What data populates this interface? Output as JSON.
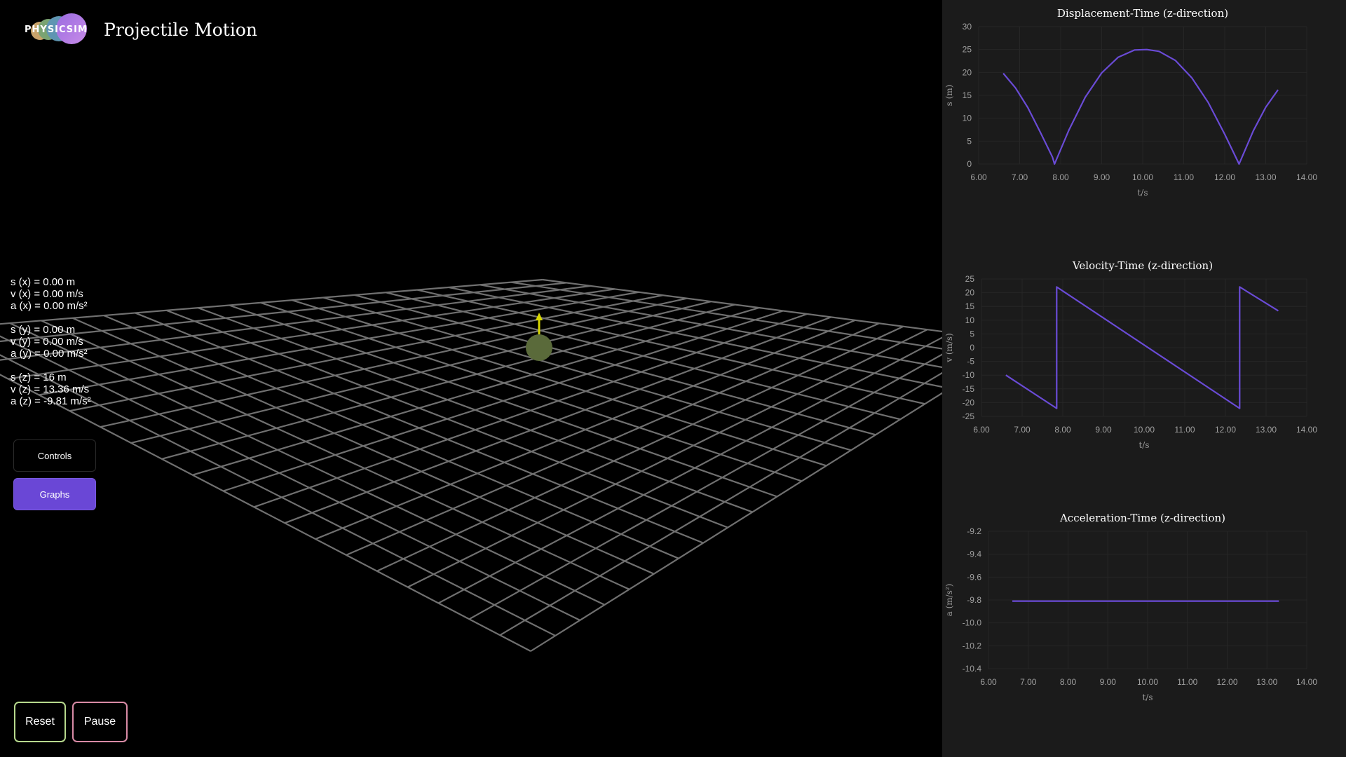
{
  "app": {
    "logo_text": "PHYSICSIM",
    "title": "Projectile Motion"
  },
  "readouts": {
    "x": [
      "s (x) = 0.00 m",
      "v (x) = 0.00 m/s",
      "a (x) = 0.00 m/s²"
    ],
    "y": [
      "s (y) = 0.00 m",
      "v (y) = 0.00 m/s",
      "a (y) = 0.00 m/s²"
    ],
    "z": [
      "s (z) = 16 m",
      "v (z) = 13.36 m/s",
      "a (z) = -9.81 m/s²"
    ]
  },
  "buttons": {
    "controls": "Controls",
    "graphs": "Graphs",
    "reset": "Reset",
    "pause": "Pause"
  },
  "colors": {
    "series": "#6a4bd6",
    "arrow": "#d6d600",
    "ball": "#5a6a3a",
    "graphs_button": "#6a47d6",
    "reset_border": "#b7d98d",
    "pause_border": "#d98ba6"
  },
  "chart_data": [
    {
      "type": "line",
      "title": "Displacement-Time (z-direction)",
      "xlabel": "t/s",
      "ylabel": "s (m)",
      "xlim": [
        6,
        14
      ],
      "ylim": [
        0,
        30
      ],
      "xticks": [
        "6.00",
        "7.00",
        "8.00",
        "9.00",
        "10.00",
        "11.00",
        "12.00",
        "13.00",
        "14.00"
      ],
      "yticks": [
        "0",
        "5",
        "10",
        "15",
        "20",
        "25",
        "30"
      ],
      "series": [
        {
          "x": [
            6.6,
            6.9,
            7.2,
            7.5,
            7.8,
            7.85,
            8.2,
            8.6,
            9.0,
            9.4,
            9.8,
            10.1,
            10.4,
            10.8,
            11.2,
            11.6,
            12.0,
            12.35,
            12.7,
            13.0,
            13.3
          ],
          "y": [
            19.8,
            16.6,
            12.3,
            7.0,
            1.5,
            0.0,
            7.4,
            14.6,
            19.9,
            23.3,
            24.9,
            25.0,
            24.6,
            22.6,
            18.8,
            13.4,
            6.5,
            0.0,
            7.3,
            12.4,
            16.2
          ]
        }
      ]
    },
    {
      "type": "line",
      "title": "Velocity-Time (z-direction)",
      "xlabel": "t/s",
      "ylabel": "v (m/s)",
      "xlim": [
        6,
        14
      ],
      "ylim": [
        -25,
        25
      ],
      "xticks": [
        "6.00",
        "7.00",
        "8.00",
        "9.00",
        "10.00",
        "11.00",
        "12.00",
        "13.00",
        "14.00"
      ],
      "yticks": [
        "-25",
        "-20",
        "-15",
        "-10",
        "-5",
        "0",
        "5",
        "10",
        "15",
        "20",
        "25"
      ],
      "series": [
        {
          "x": [
            6.6,
            7.85,
            7.85,
            12.35,
            12.35,
            13.3
          ],
          "y": [
            -10.0,
            -22.1,
            22.1,
            -22.1,
            22.1,
            13.4
          ]
        }
      ]
    },
    {
      "type": "line",
      "title": "Acceleration-Time (z-direction)",
      "xlabel": "t/s",
      "ylabel": "a (m/s²)",
      "xlim": [
        6,
        14
      ],
      "ylim": [
        -10.4,
        -9.2
      ],
      "xticks": [
        "6.00",
        "7.00",
        "8.00",
        "9.00",
        "10.00",
        "11.00",
        "12.00",
        "13.00",
        "14.00"
      ],
      "yticks": [
        "-10.4",
        "-10.2",
        "-10.0",
        "-9.8",
        "-9.6",
        "-9.4",
        "-9.2"
      ],
      "series": [
        {
          "x": [
            6.6,
            13.3
          ],
          "y": [
            -9.81,
            -9.81
          ]
        }
      ]
    }
  ]
}
